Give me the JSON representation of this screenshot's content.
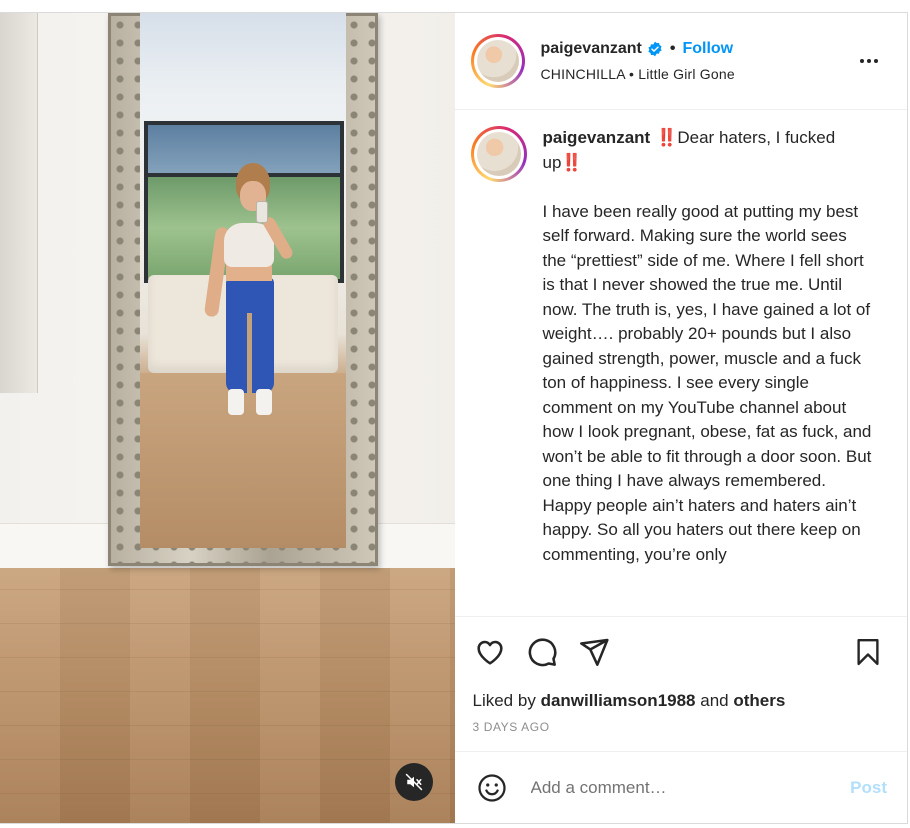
{
  "post": {
    "author": "paigevanzant",
    "follow_label": "Follow",
    "separator": "•",
    "audio": "CHINCHILLA • Little Girl Gone",
    "caption_title": "‼️Dear haters, I fucked up‼️",
    "caption_body": "\n\nI have been really good at putting my best self forward. Making sure the world sees the “prettiest” side of me. Where I fell short is that I never showed the true me. Until now. The truth is, yes, I have gained a lot of weight…. probably 20+ pounds but I also gained strength, power, muscle and a fuck ton of happiness. I see every single comment on my YouTube channel about how I look pregnant, obese, fat as fuck, and won’t be able to fit through a door soon. But one thing I have always remembered. Happy people ain’t haters and haters ain’t happy. So all you haters out there keep on commenting, you’re only",
    "liked_by_prefix": "Liked by",
    "liked_by_user": "danwilliamson1988",
    "liked_by_and": "and",
    "liked_by_others": "others",
    "time_ago": "3 DAYS AGO"
  },
  "comment": {
    "placeholder": "Add a comment…",
    "post_label": "Post"
  },
  "icons": {
    "verified": "verified-badge-icon",
    "more": "more-options-icon",
    "like": "heart-icon",
    "comment": "comment-bubble-icon",
    "share": "paper-plane-icon",
    "save": "bookmark-icon",
    "emoji": "emoji-smiley-icon",
    "mute": "speaker-muted-icon"
  },
  "colors": {
    "accent": "#0095f6",
    "post_disabled": "#b2dffc",
    "text": "#262626",
    "muted": "#8e8e8e"
  }
}
